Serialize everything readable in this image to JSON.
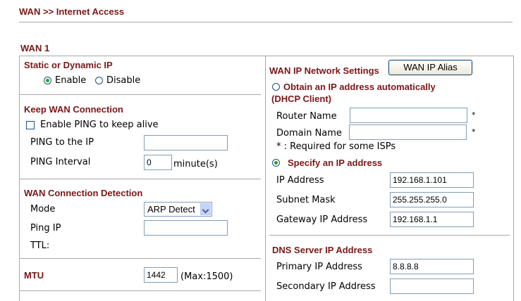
{
  "breadcrumb": "WAN >> Internet Access",
  "section_title": "WAN 1",
  "left": {
    "static_dynamic": {
      "title": "Static or Dynamic IP",
      "enable_label": "Enable",
      "disable_label": "Disable",
      "selected": "Enable"
    },
    "keep_wan": {
      "title": "Keep WAN Connection",
      "ping_checkbox_label": "Enable PING to keep alive",
      "ping_checked": false,
      "ping_ip_label": "PING to the IP",
      "ping_ip_value": "",
      "ping_interval_label": "PING Interval",
      "ping_interval_value": "0",
      "ping_interval_unit": "minute(s)"
    },
    "detection": {
      "title": "WAN Connection Detection",
      "mode_label": "Mode",
      "mode_value": "ARP Detect",
      "ping_ip_label": "Ping IP",
      "ping_ip_value": "",
      "ttl_label": "TTL:"
    },
    "mtu": {
      "label": "MTU",
      "value": "1442",
      "max_text": "(Max:1500)"
    }
  },
  "right": {
    "wan_ip": {
      "title": "WAN IP Network Settings",
      "alias_button": "WAN IP Alias",
      "obtain_label": "Obtain an IP address automatically",
      "dhcp_label": "(DHCP Client)",
      "router_name_label": "Router Name",
      "router_name_value": "",
      "domain_name_label": "Domain Name",
      "domain_name_value": "",
      "asterisk": "*",
      "required_note": "* : Required for some ISPs",
      "specify_label": "Specify an IP address",
      "selected": "specify",
      "ip_label": "IP Address",
      "ip_value": "192.168.1.101",
      "mask_label": "Subnet Mask",
      "mask_value": "255.255.255.0",
      "gateway_label": "Gateway IP Address",
      "gateway_value": "192.168.1.1"
    },
    "dns": {
      "title": "DNS Server IP Address",
      "primary_label": "Primary IP Address",
      "primary_value": "8.8.8.8",
      "secondary_label": "Secondary IP Address",
      "secondary_value": ""
    }
  }
}
